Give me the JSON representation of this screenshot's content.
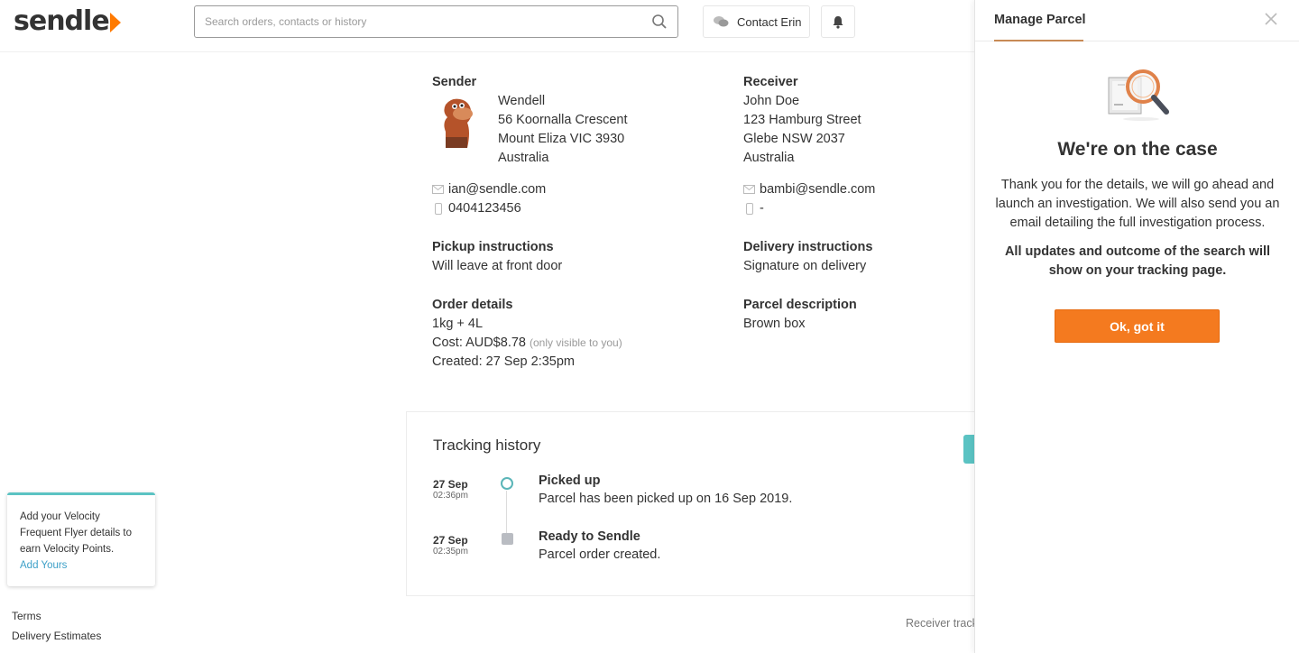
{
  "app": {
    "logo_text": "sendle",
    "brand_color": "#ff7a00",
    "accent_color": "#5bc3c3"
  },
  "header": {
    "search": {
      "placeholder": "Search orders, contacts or history",
      "icon": "search-icon"
    },
    "contact_label": "Contact Erin",
    "contact_icon": "chat-bubbles-icon",
    "bell_icon": "bell-icon"
  },
  "sender": {
    "label": "Sender",
    "name": "Wendell",
    "address_line1": "56 Koornalla Crescent",
    "address_line2": "Mount Eliza VIC 3930",
    "country": "Australia",
    "email": "ian@sendle.com",
    "phone": "0404123456"
  },
  "receiver": {
    "label": "Receiver",
    "name": "John Doe",
    "address_line1": "123 Hamburg Street",
    "address_line2": "Glebe NSW 2037",
    "country": "Australia",
    "email": "bambi@sendle.com",
    "phone": "-"
  },
  "pickup": {
    "label": "Pickup instructions",
    "value": "Will leave at front door"
  },
  "delivery": {
    "label": "Delivery instructions",
    "value": "Signature on delivery"
  },
  "order": {
    "label": "Order details",
    "size": "1kg + 4L",
    "cost": "Cost: AUD$8.78",
    "cost_note": "(only visible to you)",
    "created": "Created: 27 Sep 2:35pm"
  },
  "parcel": {
    "label": "Parcel description",
    "value": "Brown box"
  },
  "tracking": {
    "title": "Tracking history",
    "events": [
      {
        "date": "27 Sep",
        "time": "02:36pm",
        "title": "Picked up",
        "desc": "Parcel has been picked up on 16 Sep 2019."
      },
      {
        "date": "27 Sep",
        "time": "02:35pm",
        "title": "Ready to Sendle",
        "desc": "Parcel order created."
      }
    ]
  },
  "receiver_tracking_label": "Receiver track",
  "velocity": {
    "text": "Add your Velocity Frequent Flyer details to earn Velocity Points.",
    "link": "Add Yours"
  },
  "footer": {
    "terms": "Terms",
    "delivery_estimates": "Delivery Estimates"
  },
  "panel": {
    "title": "Manage Parcel",
    "heading": "We're on the case",
    "body": "Thank you for the details, we will go ahead and launch an investigation. We will also send you an email detailing the full investigation process.",
    "bold": "All updates and outcome of the search will show on your tracking page.",
    "button": "Ok, got it"
  }
}
